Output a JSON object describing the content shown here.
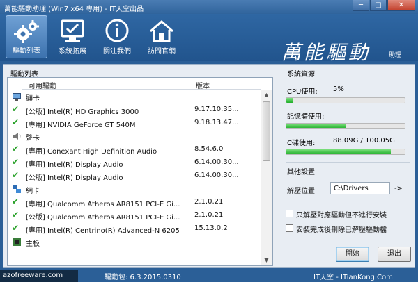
{
  "window": {
    "title": "萬能驅動助理 (Win7 x64 專用) - IT天空出品",
    "minimize": "─",
    "maximize": "□",
    "close": "✕"
  },
  "toolbar": {
    "items": [
      {
        "label": "驅動列表",
        "icon": "gears-icon",
        "active": true
      },
      {
        "label": "系統拓展",
        "icon": "monitor-check-icon",
        "active": false
      },
      {
        "label": "關注我們",
        "icon": "info-icon",
        "active": false
      },
      {
        "label": "訪問官網",
        "icon": "home-icon",
        "active": false
      }
    ],
    "brand": "萬能驅動",
    "brand_sub": "助理"
  },
  "driver_list": {
    "title": "驅動列表",
    "columns": [
      "可用驅動",
      "版本"
    ],
    "rows": [
      {
        "type": "category",
        "name": "顯卡",
        "icon": "display-card-icon"
      },
      {
        "type": "driver",
        "name": "[公版] Intel(R) HD Graphics 3000",
        "version": "9.17.10.35..."
      },
      {
        "type": "driver",
        "name": "[專用] NVIDIA GeForce GT 540M",
        "version": "9.18.13.47..."
      },
      {
        "type": "category",
        "name": "聲卡",
        "icon": "speaker-icon"
      },
      {
        "type": "driver",
        "name": "[專用] Conexant High Definition Audio",
        "version": "8.54.6.0"
      },
      {
        "type": "driver",
        "name": "[專用] Intel(R) Display Audio",
        "version": "6.14.00.30..."
      },
      {
        "type": "driver",
        "name": "[公版] Intel(R) Display Audio",
        "version": "6.14.00.30..."
      },
      {
        "type": "category",
        "name": "網卡",
        "icon": "network-icon"
      },
      {
        "type": "driver",
        "name": "[專用] Qualcomm Atheros AR8151 PCI-E Gi...",
        "version": "2.1.0.21"
      },
      {
        "type": "driver",
        "name": "[公版] Qualcomm Atheros AR8151 PCI-E Gi...",
        "version": "2.1.0.21"
      },
      {
        "type": "driver",
        "name": "[專用] Intel(R) Centrino(R) Advanced-N 6205",
        "version": "15.13.0.2"
      },
      {
        "type": "category",
        "name": "主板",
        "icon": "motherboard-icon"
      }
    ]
  },
  "resources": {
    "title": "系統資源",
    "cpu_label": "CPU使用:",
    "cpu_value": "5%",
    "cpu_percent": 5,
    "mem_label": "記憶體使用:",
    "mem_value": "",
    "mem_percent": 50,
    "disk_label": "C碟使用:",
    "disk_value": "88.09G / 100.05G",
    "disk_percent": 88
  },
  "settings": {
    "title": "其他設置",
    "path_label": "解壓位置",
    "path_value": "C:\\Drivers",
    "path_arrow": "->",
    "option1": "只解壓對應驅動但不進行安裝",
    "option2": "安裝完成後刪除已解壓驅動檔",
    "start_button": "開始",
    "exit_button": "退出"
  },
  "status": {
    "left": "azofreeware.com",
    "package": "驅動包: 6.3.2015.0310",
    "site": "IT天空 - ITianKong.Com"
  },
  "colors": {
    "accent": "#2b5f97",
    "progress": "#1fae2a",
    "check": "#2aa12a"
  }
}
